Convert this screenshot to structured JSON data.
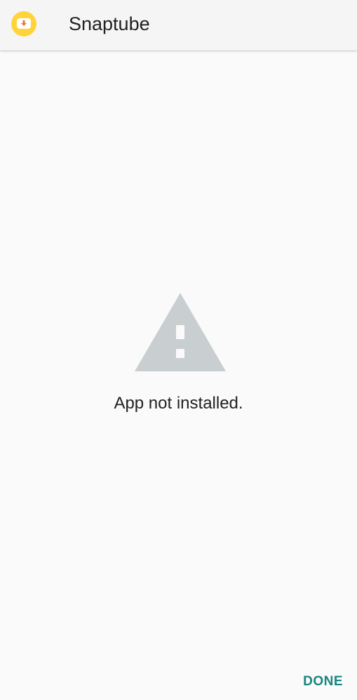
{
  "header": {
    "app_name": "Snaptube",
    "icon": "snaptube-app-icon"
  },
  "main": {
    "icon": "warning-icon",
    "message": "App not installed."
  },
  "footer": {
    "done_label": "DONE"
  },
  "colors": {
    "accent": "#16867f",
    "app_icon_yellow": "#ffd43b",
    "app_icon_orange": "#f37321",
    "warning_gray": "#c9ced1"
  }
}
